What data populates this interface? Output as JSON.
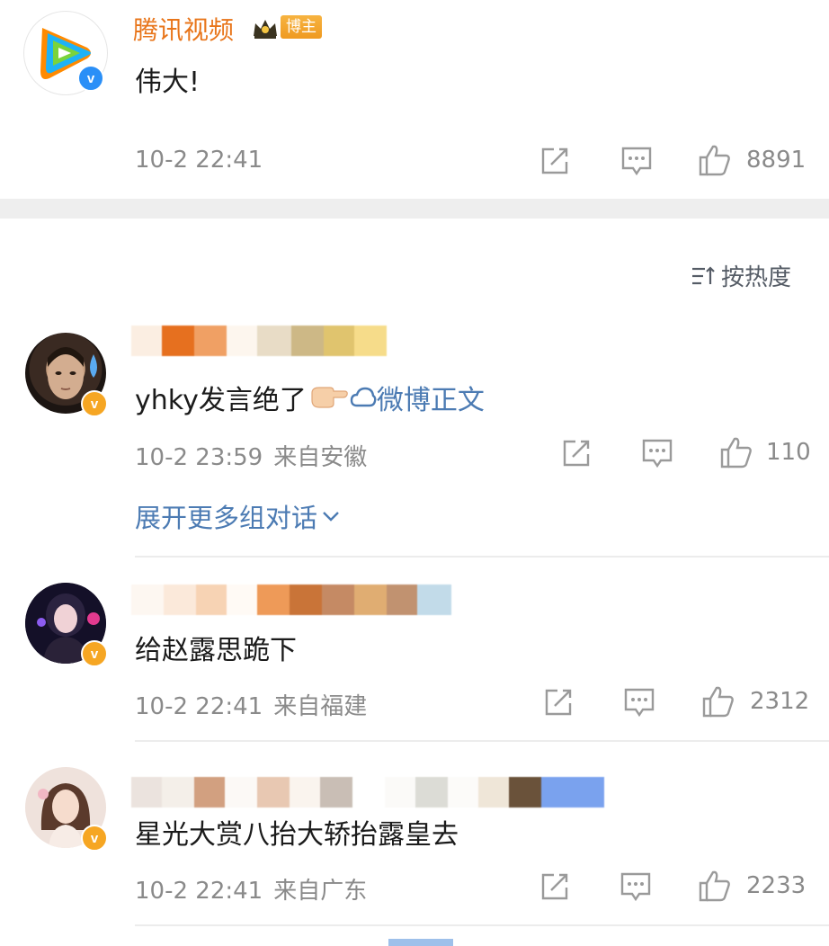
{
  "post": {
    "author": "腾讯视频",
    "badge_label": "博主",
    "text": "伟大!",
    "time": "10-2 22:41",
    "like_count": "8891"
  },
  "sort": {
    "label": "按热度"
  },
  "comments": [
    {
      "text_before_emoji": "yhky发言绝了",
      "link_text": "微博正文",
      "time": "10-2 23:59",
      "location": "来自安徽",
      "like_count": "110",
      "expand_label": "展开更多组对话"
    },
    {
      "text": "给赵露思跪下",
      "time": "10-2 22:41",
      "location": "来自福建",
      "like_count": "2312"
    },
    {
      "text": "星光大赏八抬大轿抬露皇去",
      "time": "10-2 22:41",
      "location": "来自广东",
      "like_count": "2233"
    }
  ],
  "icons": {
    "share": "share-icon",
    "comment": "comment-icon",
    "like": "thumb-up-icon",
    "sort": "sort-icon",
    "chevron": "chevron-down-icon",
    "verified": "verified-v-icon"
  },
  "colors": {
    "author_orange": "#e8751a",
    "link_blue": "#4c7bb3",
    "meta_gray": "#8a8a8a",
    "separator": "#eeeeee"
  }
}
